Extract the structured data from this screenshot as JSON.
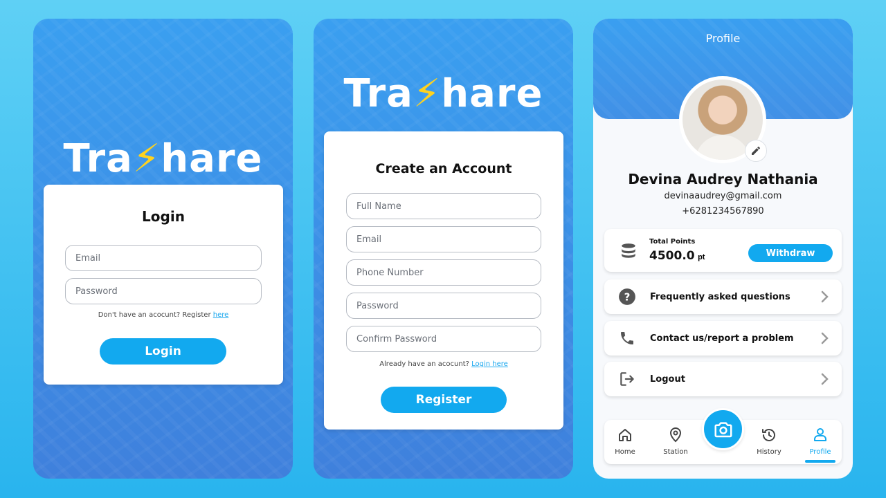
{
  "brand": {
    "logo_part1": "Tra",
    "logo_bolt": "s",
    "logo_part2": "hare",
    "accent_color": "#12a9ef",
    "bolt_color": "#ffd21f"
  },
  "login": {
    "title": "Login",
    "email_placeholder": "Email",
    "password_placeholder": "Password",
    "hint_text": "Don't have an acocunt? Register ",
    "hint_link": "here",
    "button_label": "Login"
  },
  "register": {
    "title": "Create an Account",
    "fullname_placeholder": "Full Name",
    "email_placeholder": "Email",
    "phone_placeholder": "Phone Number",
    "password_placeholder": "Password",
    "confirm_placeholder": "Confirm Password",
    "hint_text": "Already have an acocunt? ",
    "hint_link": "Login here",
    "button_label": "Register"
  },
  "profile": {
    "title": "Profile",
    "name": "Devina Audrey Nathania",
    "email": "devinaaudrey@gmail.com",
    "phone": "+6281234567890",
    "points_label": "Total Points",
    "points_value": "4500.0",
    "points_unit": "pt",
    "withdraw_label": "Withdraw",
    "menu": [
      {
        "label": "Frequently asked questions",
        "icon": "question-circle-icon"
      },
      {
        "label": "Contact us/report a problem",
        "icon": "phone-icon"
      },
      {
        "label": "Logout",
        "icon": "logout-icon"
      }
    ],
    "nav": [
      {
        "label": "Home",
        "icon": "home-icon"
      },
      {
        "label": "Station",
        "icon": "location-pin-icon"
      },
      {
        "label": "History",
        "icon": "history-icon"
      },
      {
        "label": "Profile",
        "icon": "user-icon",
        "active": true
      }
    ]
  }
}
